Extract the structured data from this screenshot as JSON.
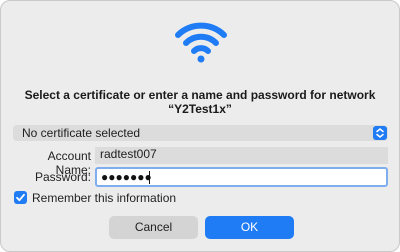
{
  "dialog": {
    "icon": "wifi-icon",
    "title_line1": "Select a certificate or enter a name and password for network",
    "title_line2": "“Y2Test1x”"
  },
  "certificate": {
    "selected": "No certificate selected",
    "icon": "chevron-updown-icon"
  },
  "account": {
    "label": "Account Name:",
    "value": "radtest007"
  },
  "password": {
    "label": "Password:",
    "masked_value": "●●●●●●●"
  },
  "remember": {
    "label": "Remember this information",
    "checked": true
  },
  "buttons": {
    "cancel": "Cancel",
    "ok": "OK"
  },
  "colors": {
    "accent": "#1f7cf5",
    "background": "#ececec",
    "field": "#dcdcdc"
  }
}
